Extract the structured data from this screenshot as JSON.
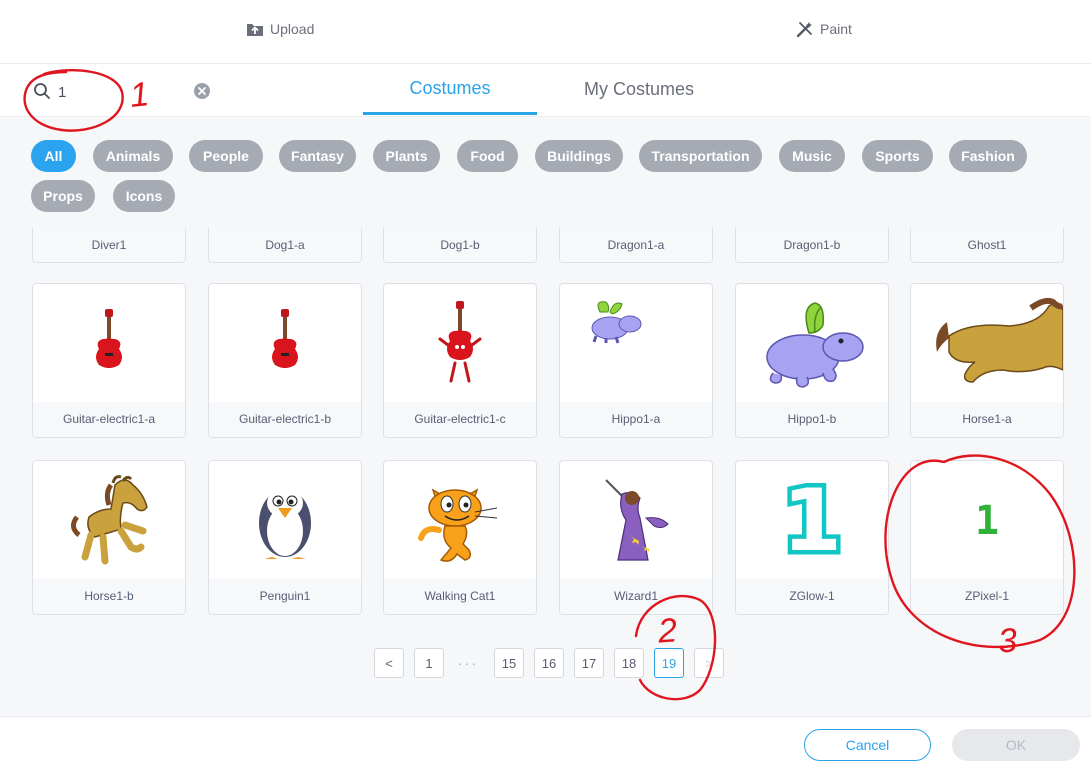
{
  "top": {
    "upload_label": "Upload",
    "paint_label": "Paint"
  },
  "search": {
    "value": "1",
    "placeholder": ""
  },
  "tabs": {
    "costumes": "Costumes",
    "my_costumes": "My Costumes"
  },
  "filters": [
    "All",
    "Animals",
    "People",
    "Fantasy",
    "Plants",
    "Food",
    "Buildings",
    "Transportation",
    "Music",
    "Sports",
    "Fashion",
    "Props",
    "Icons"
  ],
  "grid": {
    "row0": [
      "Diver1",
      "Dog1-a",
      "Dog1-b",
      "Dragon1-a",
      "Dragon1-b",
      "Ghost1"
    ],
    "row1": [
      "Guitar-electric1-a",
      "Guitar-electric1-b",
      "Guitar-electric1-c",
      "Hippo1-a",
      "Hippo1-b",
      "Horse1-a"
    ],
    "row2": [
      "Horse1-b",
      "Penguin1",
      "Walking Cat1",
      "Wizard1",
      "ZGlow-1",
      "ZPixel-1"
    ]
  },
  "thumb_glyphs": {
    "zglow": "1",
    "zpixel": "1"
  },
  "pagination": {
    "prev": "<",
    "p1": "1",
    "ellipsis": "···",
    "p15": "15",
    "p16": "16",
    "p17": "17",
    "p18": "18",
    "p19": "19",
    "next": ">"
  },
  "footer": {
    "cancel_label": "Cancel",
    "ok_label": "OK"
  },
  "annotations": {
    "a1": "1",
    "a2": "2",
    "a3": "3"
  },
  "colors": {
    "accent": "#29a3e8",
    "chip": "#a5aab3",
    "annotation": "#e0161e"
  }
}
